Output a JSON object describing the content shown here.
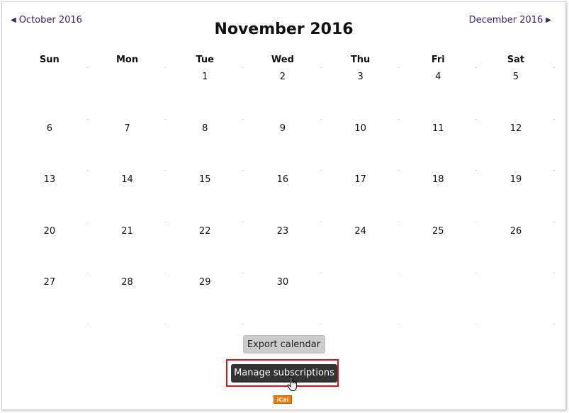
{
  "nav": {
    "prev_label": "October 2016",
    "next_label": "December 2016",
    "prev_arrow": "◀",
    "next_arrow": "▶"
  },
  "title": "November 2016",
  "weekdays": [
    "Sun",
    "Mon",
    "Tue",
    "Wed",
    "Thu",
    "Fri",
    "Sat"
  ],
  "weeks": [
    [
      "",
      "",
      "1",
      "2",
      "3",
      "4",
      "5"
    ],
    [
      "6",
      "7",
      "8",
      "9",
      "10",
      "11",
      "12"
    ],
    [
      "13",
      "14",
      "15",
      "16",
      "17",
      "18",
      "19"
    ],
    [
      "20",
      "21",
      "22",
      "23",
      "24",
      "25",
      "26"
    ],
    [
      "27",
      "28",
      "29",
      "30",
      "",
      "",
      ""
    ]
  ],
  "buttons": {
    "export_label": "Export calendar",
    "manage_label": "Manage subscriptions"
  },
  "ical_badge": "iCal",
  "colors": {
    "link": "#3a1d70",
    "highlight": "#d9141e",
    "manage_bg": "#333333",
    "export_bg": "#cccccc",
    "ical": "#f47b00"
  }
}
